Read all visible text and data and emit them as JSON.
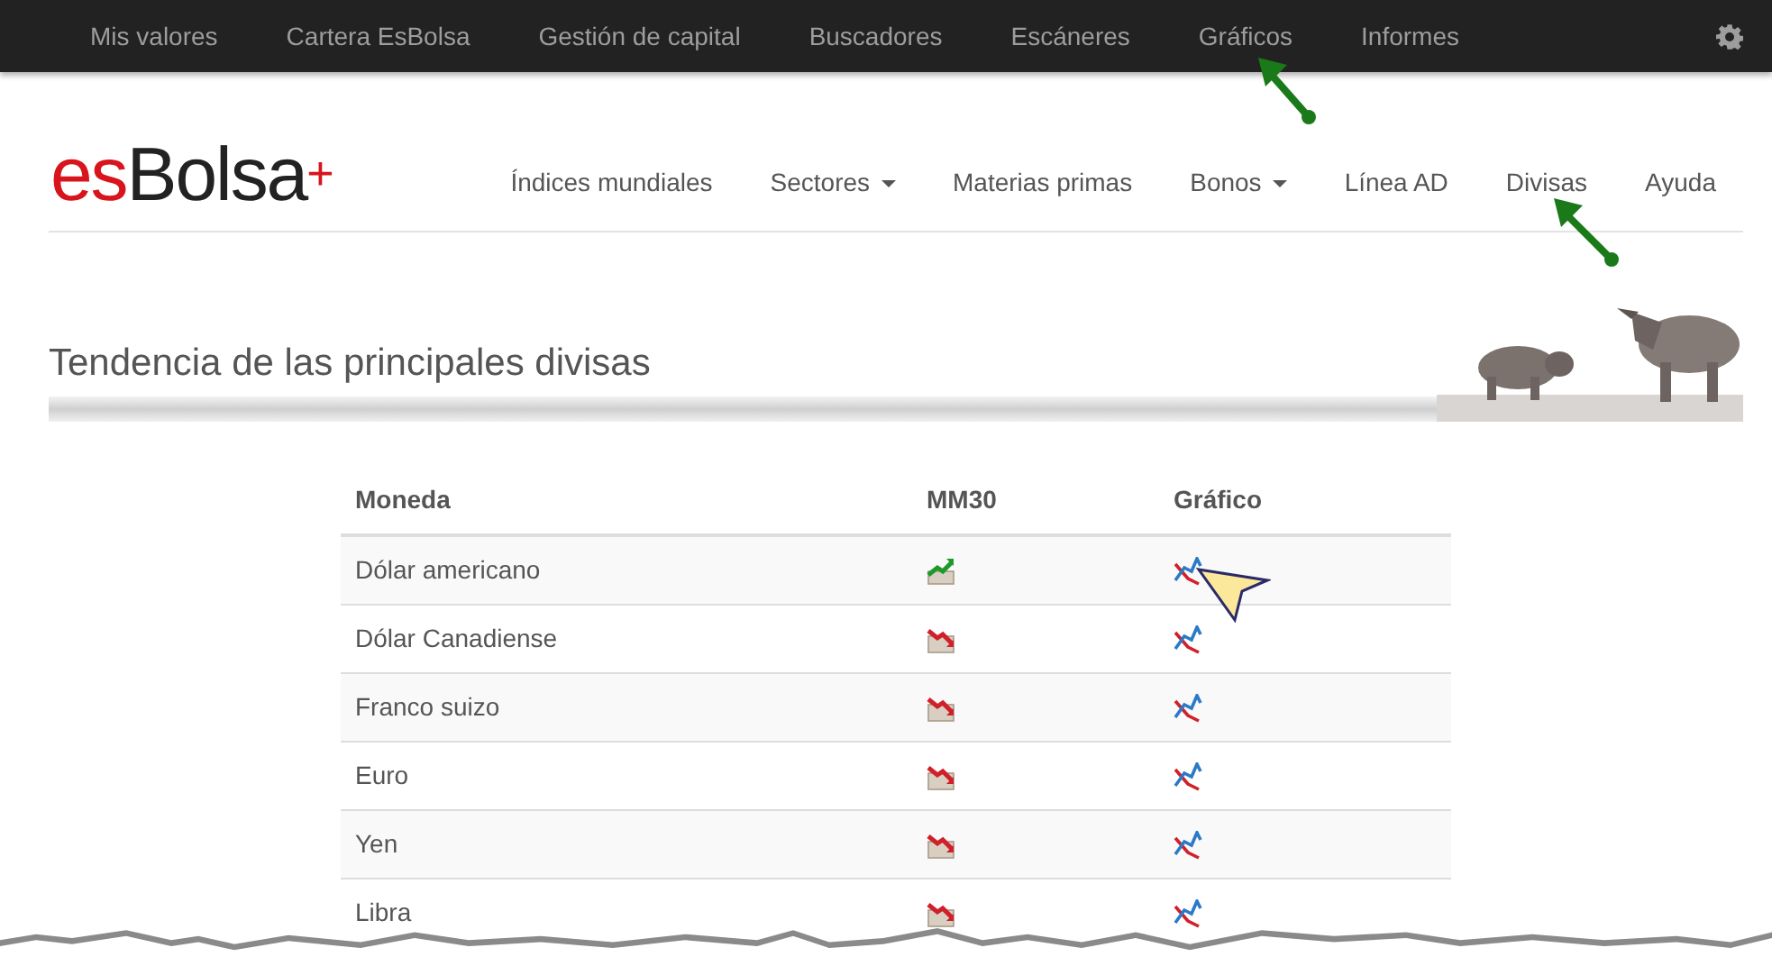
{
  "top_nav": [
    {
      "label": "Mis valores"
    },
    {
      "label": "Cartera EsBolsa"
    },
    {
      "label": "Gestión de capital"
    },
    {
      "label": "Buscadores"
    },
    {
      "label": "Escáneres"
    },
    {
      "label": "Gráficos"
    },
    {
      "label": "Informes"
    }
  ],
  "logo": {
    "prefix": "es",
    "name": "Bolsa",
    "mark": "+"
  },
  "main_nav": [
    {
      "label": "Índices mundiales",
      "dropdown": false
    },
    {
      "label": "Sectores",
      "dropdown": true
    },
    {
      "label": "Materias primas",
      "dropdown": false
    },
    {
      "label": "Bonos",
      "dropdown": true
    },
    {
      "label": "Línea AD",
      "dropdown": false
    },
    {
      "label": "Divisas",
      "dropdown": false
    },
    {
      "label": "Ayuda",
      "dropdown": false
    }
  ],
  "page_title": "Tendencia de las principales divisas",
  "table": {
    "columns": [
      "Moneda",
      "MM30",
      "Gráfico"
    ],
    "rows": [
      {
        "currency": "Dólar americano",
        "rising": true
      },
      {
        "currency": "Dólar Canadiense",
        "rising": false
      },
      {
        "currency": "Franco suizo",
        "rising": false
      },
      {
        "currency": "Euro",
        "rising": false
      },
      {
        "currency": "Yen",
        "rising": false
      },
      {
        "currency": "Libra",
        "rising": false
      }
    ]
  }
}
